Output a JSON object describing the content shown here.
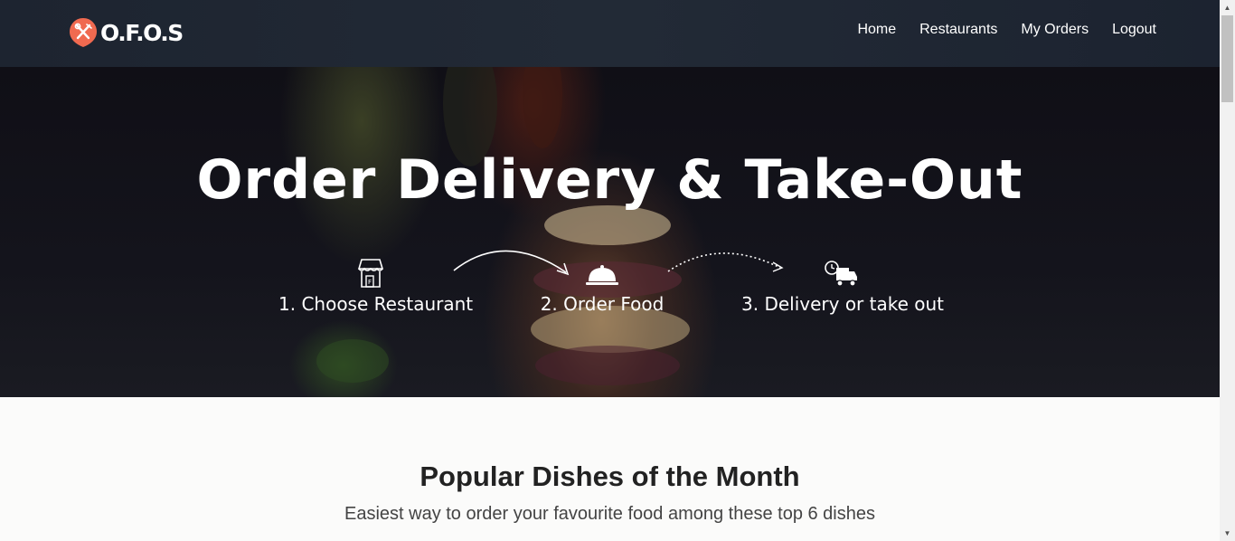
{
  "brand": {
    "name": "O.F.O.S",
    "accent": "#f06a50"
  },
  "nav": {
    "items": [
      {
        "label": "Home"
      },
      {
        "label": "Restaurants"
      },
      {
        "label": "My Orders"
      },
      {
        "label": "Logout"
      }
    ]
  },
  "hero": {
    "title": "Order Delivery & Take-Out",
    "steps": [
      {
        "label": "1. Choose Restaurant",
        "icon": "storefront-icon"
      },
      {
        "label": "2. Order Food",
        "icon": "food-cloche-icon"
      },
      {
        "label": "3. Delivery or take out",
        "icon": "delivery-truck-icon"
      }
    ]
  },
  "popular": {
    "title": "Popular Dishes of the Month",
    "subtitle": "Easiest way to order your favourite food among these top 6 dishes"
  }
}
